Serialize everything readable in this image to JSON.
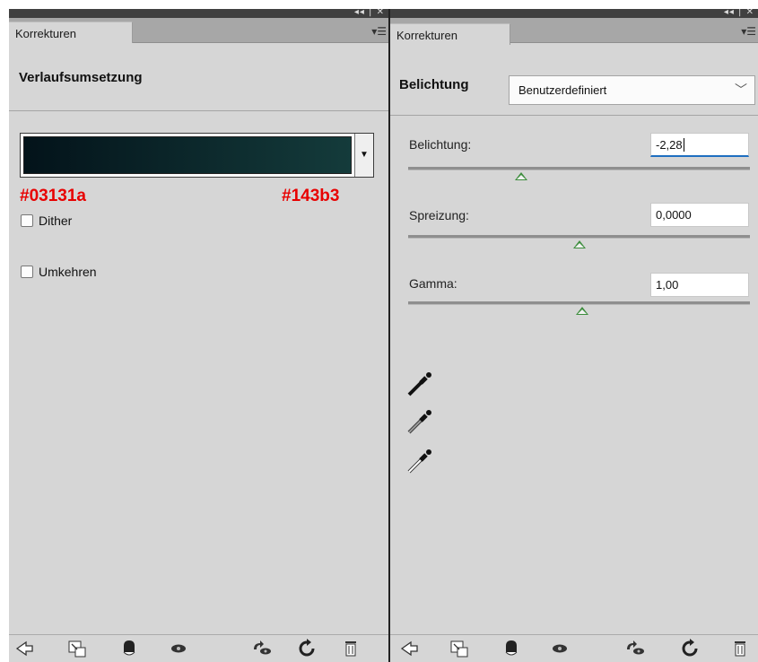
{
  "left_panel": {
    "tab_label": "Korrekturen",
    "title": "Verlaufsumsetzung",
    "gradient_colors": {
      "start": "#03131a",
      "end": "#143b3b"
    },
    "annotation_start": "#03131a",
    "annotation_end": "#143b3",
    "checkboxes": [
      {
        "label": "Dither",
        "checked": false
      },
      {
        "label": "Umkehren",
        "checked": false
      }
    ]
  },
  "right_panel": {
    "tab_label": "Korrekturen",
    "title": "Belichtung",
    "preset_value": "Benutzerdefiniert",
    "params": [
      {
        "label": "Belichtung:",
        "value": "-2,28",
        "slider_fraction": 0.33
      },
      {
        "label": "Spreizung:",
        "value": "0,0000",
        "slider_fraction": 0.5
      },
      {
        "label": "Gamma:",
        "value": "1,00",
        "slider_fraction": 0.51
      }
    ]
  },
  "icons": {
    "panel_controls": "collapse-close-icons",
    "panel_menu": "panel-menu-icon",
    "eyedroppers": [
      "black-eyedropper-icon",
      "gray-eyedropper-icon",
      "white-eyedropper-icon"
    ],
    "bottom_toolbar": [
      "back-arrow-icon",
      "clip-to-layer-icon",
      "layer-mask-icon",
      "visibility-eye-icon",
      "view-previous-state-icon",
      "reset-icon",
      "trash-icon"
    ]
  },
  "colors": {
    "panel_bg": "#d6d6d6",
    "annotation": "#e80000",
    "thumb": "#3d8d3d",
    "active_field_underline": "#1f6fc1"
  }
}
